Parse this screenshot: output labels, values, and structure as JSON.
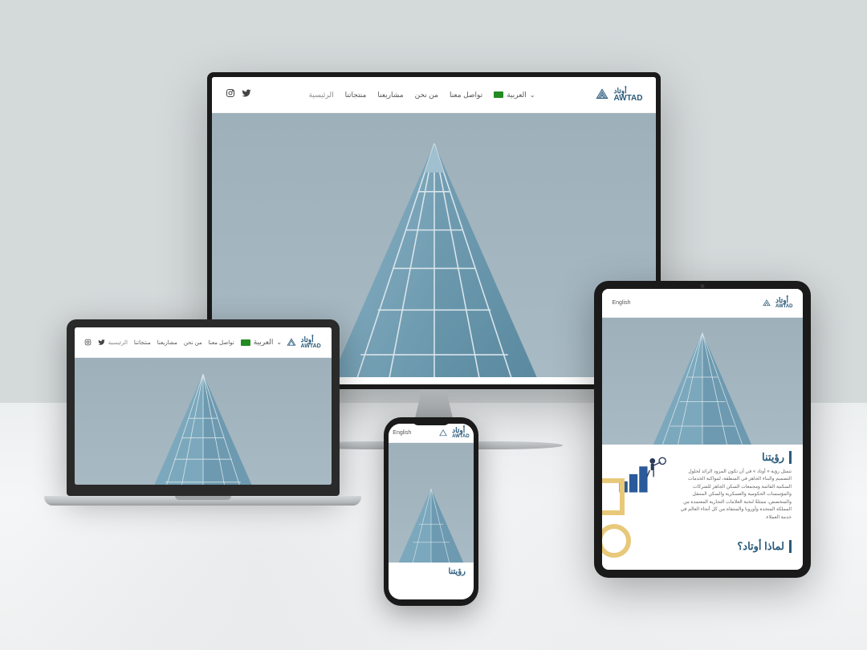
{
  "brand": {
    "name_en": "AWTAD",
    "name_ar": "أوتاد"
  },
  "nav": {
    "home": "الرئيسية",
    "products": "منتجاتنا",
    "projects": "مشاريعنا",
    "about": "من نحن",
    "contact": "تواصل معنا"
  },
  "lang": {
    "label": "العربية",
    "alt": "English"
  },
  "tablet": {
    "vision_title": "رؤيتنا",
    "vision_text": "تتمثل رؤية « أوتاد » في أن تكون المزود الرائد لحلول التصميم والبناء الجاهز في المنطقة، لمواكبة الخدمات السكنية القائمة ومجمعات السكن الجاهز للشركات والمؤسسات الحكومية والعسكرية والسكن المتنقل والمتخصص، ممثلةً لنخبة العلامات التجارية المعتمدة من المملكة المتحدة وأوروبا والمنتقاة من كل أنحاء العالم في خدمة العملاء.",
    "why_title": "لماذا أوتاد؟"
  },
  "phone": {
    "vision_title": "رؤيتنا"
  }
}
